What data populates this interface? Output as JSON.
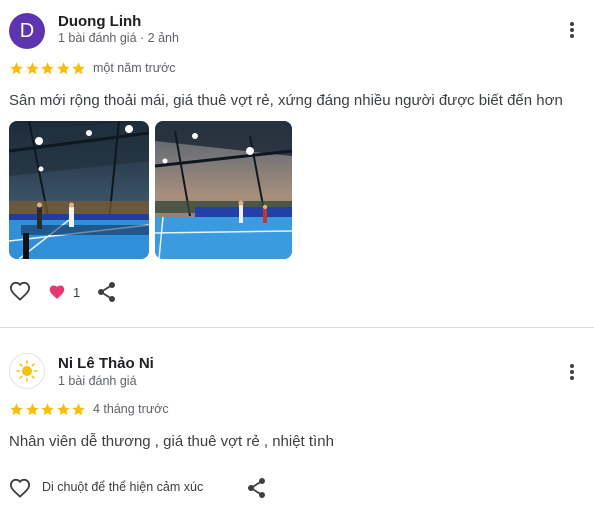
{
  "reviews": [
    {
      "avatar_letter": "D",
      "name": "Duong Linh",
      "meta": "1 bài đánh giá · 2 ảnh",
      "rating": 5,
      "when": "một năm trước",
      "text": "Sân mới rộng thoải mái, giá thuê vợt rẻ, xứng đáng nhiều người được biết đến hơn",
      "photos": [
        "pickleball-court-photo",
        "pickleball-court-photo"
      ],
      "reaction_count": "1"
    },
    {
      "avatar_icon": "sun-icon",
      "name": "Ni Lê Thảo Ni",
      "meta": "1 bài đánh giá",
      "rating": 5,
      "when": "4 tháng trước",
      "text": "Nhân viên dễ thương , giá thuê vợt rẻ , nhiệt tình",
      "reaction_hint": "Di chuột để thể hiện cảm xúc"
    }
  ],
  "colors": {
    "star": "#fbbc04",
    "avatar_bg": "#5e35b1",
    "heart": "#e53970",
    "divider": "#dadce0"
  }
}
